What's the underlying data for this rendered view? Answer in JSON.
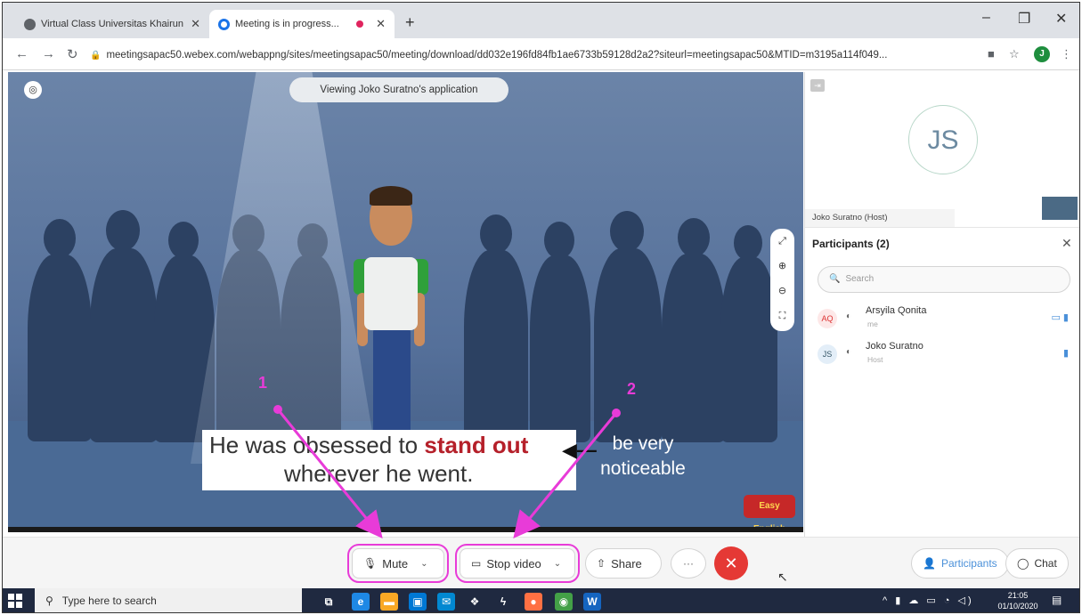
{
  "browser": {
    "tabs": [
      {
        "title": "Virtual Class Universitas Khairun",
        "active": false
      },
      {
        "title": "Meeting is in progress...",
        "active": true
      }
    ],
    "url": "meetingsapac50.webex.com/webappng/sites/meetingsapac50/meeting/download/dd032e196fd84fb1ae6733b59128d2a2?siteurl=meetingsapac50&MTID=m3195a114f049...",
    "profile_initial": "J"
  },
  "stage": {
    "viewing_label": "Viewing Joko Suratno's application",
    "caption_line1_prefix": "He was obsessed to ",
    "caption_line1_highlight": "stand out",
    "caption_line2": "wherever he went.",
    "side_note": "be very noticeable",
    "brand": "Easy English"
  },
  "annotations": {
    "one": "1",
    "two": "2"
  },
  "video_tile": {
    "initials": "JS",
    "name": "Joko Suratno (Host)"
  },
  "participants": {
    "title": "Participants (2)",
    "search_placeholder": "Search",
    "list": [
      {
        "initials": "AQ",
        "name": "Arsyila Qonita",
        "role": "me"
      },
      {
        "initials": "JS",
        "name": "Joko Suratno",
        "role": "Host"
      }
    ]
  },
  "controls": {
    "mute_label": "Mute",
    "stop_video_label": "Stop video",
    "share_label": "Share",
    "participants_label": "Participants",
    "chat_label": "Chat"
  },
  "taskbar": {
    "search_placeholder": "Type here to search",
    "time": "21:05",
    "date": "01/10/2020"
  },
  "colors": {
    "annotation": "#e83bd8",
    "end_call": "#e53935",
    "accent": "#4a90d9"
  }
}
